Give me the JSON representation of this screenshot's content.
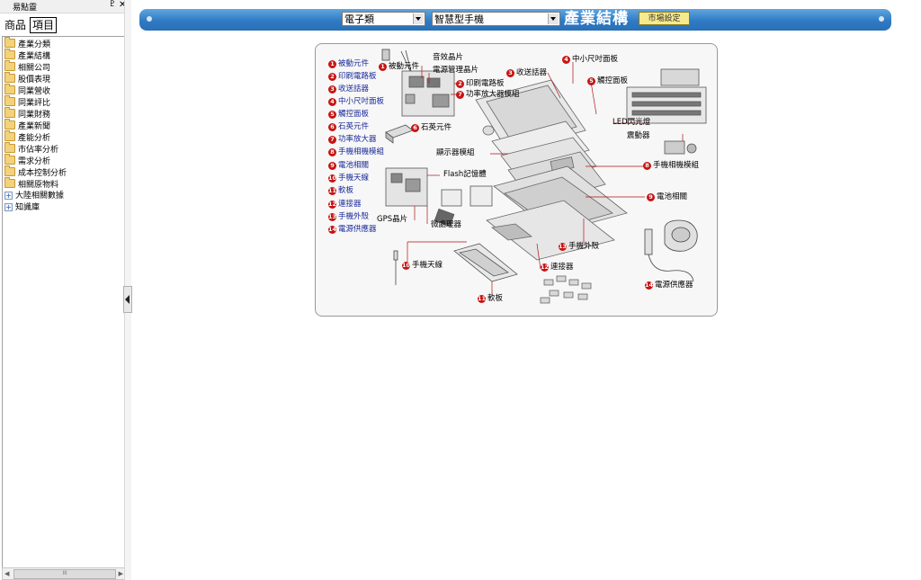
{
  "panel": {
    "title": "易點靈",
    "pin_glyph": "♇",
    "close_glyph": "✕",
    "tabs": [
      "商品",
      "項目"
    ],
    "active_tab": "項目",
    "tree": [
      {
        "label": "產業分類",
        "type": "folder"
      },
      {
        "label": "產業結構",
        "type": "folder"
      },
      {
        "label": "相關公司",
        "type": "folder"
      },
      {
        "label": "股價表現",
        "type": "folder"
      },
      {
        "label": "同業營收",
        "type": "folder"
      },
      {
        "label": "同業評比",
        "type": "folder"
      },
      {
        "label": "同業財務",
        "type": "folder"
      },
      {
        "label": "產業新聞",
        "type": "folder"
      },
      {
        "label": "產能分析",
        "type": "folder"
      },
      {
        "label": "市佔率分析",
        "type": "folder"
      },
      {
        "label": "需求分析",
        "type": "folder"
      },
      {
        "label": "成本控制分析",
        "type": "folder"
      },
      {
        "label": "相關原物料",
        "type": "folder"
      },
      {
        "label": "大陸相關數據",
        "type": "expandable"
      },
      {
        "label": "知識庫",
        "type": "expandable"
      }
    ],
    "expand_glyph": "+",
    "scroll_thumb_glyph": "III",
    "scroll_left_glyph": "◀",
    "scroll_right_glyph": "▶"
  },
  "toolbar": {
    "category_value": "電子類",
    "product_value": "智慧型手機",
    "title": "產業結構",
    "market_button": "市場設定"
  },
  "diagram": {
    "legend": [
      {
        "n": "1",
        "label": "被動元件"
      },
      {
        "n": "2",
        "label": "印刷電路板"
      },
      {
        "n": "3",
        "label": "收送話器"
      },
      {
        "n": "4",
        "label": "中小尺吋面板"
      },
      {
        "n": "5",
        "label": "觸控面板"
      },
      {
        "n": "6",
        "label": "石英元件"
      },
      {
        "n": "7",
        "label": "功率放大器"
      },
      {
        "n": "8",
        "label": "手機相機模組"
      },
      {
        "n": "9",
        "label": "電池相關"
      },
      {
        "n": "10",
        "label": "手機天線"
      },
      {
        "n": "11",
        "label": "軟板"
      },
      {
        "n": "12",
        "label": "連接器"
      },
      {
        "n": "13",
        "label": "手機外殼"
      },
      {
        "n": "14",
        "label": "電源供應器"
      }
    ],
    "callouts": {
      "passive": {
        "n": "1",
        "label": "被動元件"
      },
      "audio_chip": "音效晶片",
      "power_chip": "電源管理晶片",
      "pcb": {
        "n": "2",
        "label": "印刷電路板"
      },
      "pa_module": {
        "n": "7",
        "label": "功率放大器模組"
      },
      "crystal": {
        "n": "6",
        "label": "石英元件"
      },
      "receiver": {
        "n": "3",
        "label": "收送話器"
      },
      "small_panel": {
        "n": "4",
        "label": "中小尺吋面板"
      },
      "touch": {
        "n": "5",
        "label": "觸控面板"
      },
      "led": "LED閃光燈",
      "vibrator": "震動器",
      "display_module": "顯示器模組",
      "flash_memory": "Flash記憶體",
      "camera": {
        "n": "8",
        "label": "手機相機模組"
      },
      "battery": {
        "n": "9",
        "label": "電池相關"
      },
      "gps": "GPS晶片",
      "processor": "微處理器",
      "case": {
        "n": "13",
        "label": "手機外殼"
      },
      "antenna": {
        "n": "10",
        "label": "手機天線"
      },
      "connector": {
        "n": "12",
        "label": "連接器"
      },
      "flex": {
        "n": "11",
        "label": "軟板"
      },
      "psu": {
        "n": "14",
        "label": "電源供應器"
      }
    }
  },
  "colors": {
    "bar_top": "#5fa6df",
    "bar_bottom": "#2a6fb4",
    "legend_text": "#1a2a9a",
    "badge": "#c81414",
    "button_bg": "#f6e98e"
  }
}
